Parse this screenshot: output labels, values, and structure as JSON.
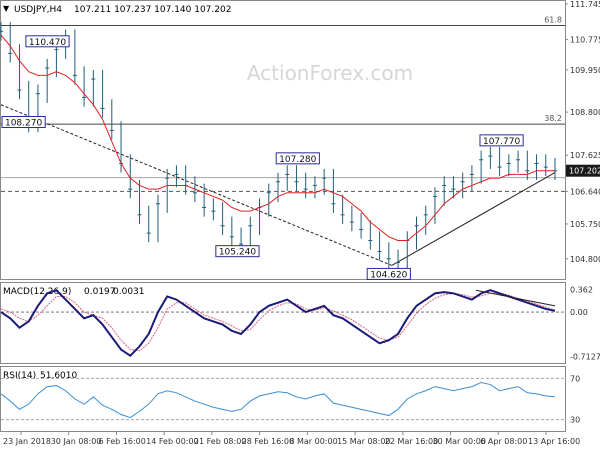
{
  "chart_data": {
    "type": "line",
    "symbol_label": "USDJPY,H4",
    "ohlc_readout": "107.211 107.237 107.140 107.202",
    "watermark": "ActionForex.com",
    "price_axis": {
      "ticks": [
        "111.745",
        "110.775",
        "109.950",
        "108.800",
        "107.625",
        "106.640",
        "105.750",
        "104.800"
      ],
      "ylim": [
        104.25,
        111.8
      ]
    },
    "current_price": {
      "value": 107.202,
      "label": "107.202"
    },
    "support_line": {
      "value": 106.64,
      "label": "106.640"
    },
    "fib_levels": [
      {
        "label": "61.8",
        "value": 111.16
      },
      {
        "label": "38.2",
        "value": 108.47
      }
    ],
    "level_line_107010": {
      "value": 107.01,
      "label": "107.010"
    },
    "annotations": [
      {
        "label": "110.470",
        "value": 110.47,
        "index": 47
      },
      {
        "label": "108.270",
        "value": 108.27,
        "index": 2
      },
      {
        "label": "107.280",
        "value": 107.28,
        "index": 300
      },
      {
        "label": "105.240",
        "value": 105.24,
        "index": 239
      },
      {
        "label": "104.620",
        "value": 104.62,
        "index": 392
      },
      {
        "label": "107.770",
        "value": 107.77,
        "index": 506
      }
    ],
    "trendlines": [
      {
        "from": [
          0,
          109.0
        ],
        "to": [
          395,
          104.62
        ]
      },
      {
        "from": [
          395,
          104.62
        ],
        "to": [
          560,
          107.15
        ]
      }
    ],
    "series": [
      {
        "name": "price",
        "values": [
          111.0,
          110.4,
          109.4,
          108.5,
          109.3,
          110.0,
          110.5,
          110.8,
          109.8,
          109.2,
          109.7,
          108.9,
          108.3,
          107.4,
          106.7,
          106.0,
          105.5,
          106.3,
          107.0,
          107.1,
          106.8,
          106.6,
          106.2,
          106.1,
          105.7,
          105.4,
          105.2,
          105.7,
          106.2,
          106.6,
          106.9,
          107.1,
          106.9,
          106.7,
          106.8,
          107.0,
          106.3,
          106.0,
          105.8,
          105.6,
          105.3,
          105.0,
          104.8,
          104.7,
          105.3,
          105.7,
          106.0,
          106.5,
          106.8,
          106.7,
          106.9,
          107.1,
          107.5,
          107.6,
          107.3,
          107.4,
          107.5,
          107.2,
          107.4,
          107.3,
          107.2
        ]
      },
      {
        "name": "sma",
        "values": [
          110.9,
          110.6,
          110.2,
          109.9,
          109.8,
          109.8,
          109.9,
          109.8,
          109.6,
          109.3,
          109.0,
          108.6,
          108.0,
          107.4,
          107.0,
          106.8,
          106.7,
          106.7,
          106.8,
          106.8,
          106.8,
          106.7,
          106.6,
          106.5,
          106.4,
          106.2,
          106.1,
          106.1,
          106.2,
          106.3,
          106.5,
          106.6,
          106.6,
          106.6,
          106.6,
          106.7,
          106.6,
          106.5,
          106.3,
          106.1,
          105.8,
          105.6,
          105.4,
          105.3,
          105.3,
          105.5,
          105.7,
          106.0,
          106.3,
          106.5,
          106.7,
          106.8,
          106.9,
          107.0,
          107.0,
          107.1,
          107.1,
          107.1,
          107.2,
          107.2,
          107.2
        ]
      }
    ],
    "macd": {
      "label": "MACD(12,26,9)",
      "value_a": "0.0197",
      "value_b": "0.0031",
      "ticks": [
        "0.362",
        "0.00",
        "-0.7127"
      ],
      "ylim": [
        -0.8,
        0.45
      ],
      "series": [
        {
          "name": "macd",
          "values": [
            0.0,
            -0.1,
            -0.25,
            -0.15,
            0.1,
            0.3,
            0.35,
            0.2,
            0.05,
            -0.1,
            -0.05,
            -0.2,
            -0.4,
            -0.6,
            -0.7,
            -0.55,
            -0.35,
            0.0,
            0.25,
            0.2,
            0.1,
            0.0,
            -0.1,
            -0.15,
            -0.2,
            -0.3,
            -0.35,
            -0.2,
            0.0,
            0.1,
            0.15,
            0.2,
            0.1,
            0.0,
            0.05,
            0.1,
            -0.05,
            -0.1,
            -0.2,
            -0.3,
            -0.4,
            -0.5,
            -0.45,
            -0.35,
            -0.1,
            0.1,
            0.2,
            0.3,
            0.32,
            0.3,
            0.25,
            0.2,
            0.3,
            0.35,
            0.3,
            0.25,
            0.2,
            0.15,
            0.1,
            0.05,
            0.02
          ]
        },
        {
          "name": "signal",
          "values": [
            0.05,
            0.0,
            -0.1,
            -0.15,
            -0.05,
            0.1,
            0.25,
            0.25,
            0.15,
            0.0,
            -0.05,
            -0.1,
            -0.25,
            -0.45,
            -0.6,
            -0.62,
            -0.5,
            -0.25,
            0.05,
            0.15,
            0.15,
            0.05,
            -0.05,
            -0.1,
            -0.15,
            -0.22,
            -0.3,
            -0.28,
            -0.12,
            0.02,
            0.1,
            0.15,
            0.13,
            0.05,
            0.03,
            0.07,
            0.02,
            -0.05,
            -0.12,
            -0.22,
            -0.32,
            -0.42,
            -0.45,
            -0.4,
            -0.22,
            -0.02,
            0.12,
            0.22,
            0.28,
            0.3,
            0.28,
            0.24,
            0.26,
            0.3,
            0.3,
            0.27,
            0.22,
            0.18,
            0.13,
            0.08,
            0.03
          ]
        }
      ]
    },
    "rsi": {
      "label": "RSI(14)",
      "value": "51.6010",
      "ticks": [
        "70",
        "30"
      ],
      "ylim": [
        20,
        80
      ],
      "values": [
        55,
        48,
        40,
        45,
        55,
        62,
        63,
        58,
        50,
        45,
        52,
        44,
        40,
        35,
        32,
        38,
        45,
        55,
        58,
        56,
        52,
        48,
        45,
        42,
        40,
        38,
        40,
        48,
        53,
        55,
        57,
        56,
        52,
        50,
        53,
        55,
        46,
        44,
        42,
        40,
        38,
        36,
        34,
        40,
        50,
        55,
        58,
        62,
        60,
        58,
        60,
        62,
        66,
        64,
        58,
        60,
        62,
        56,
        55,
        53,
        52
      ]
    },
    "x_axis": {
      "labels": [
        "23 Jan 2018",
        "30 Jan 08:00",
        "6 Feb 16:00",
        "14 Feb 00:00",
        "21 Feb 08:00",
        "28 Feb 16:00",
        "8 Mar 00:00",
        "15 Mar 08:00",
        "22 Mar 16:00",
        "30 Mar 00:00",
        "6 Apr 08:00",
        "13 Apr 16:00"
      ]
    },
    "colors": {
      "price": "#1f5f7a",
      "sma": "#e02020",
      "macd": "#1a1a7a",
      "signal": "#e06080",
      "rsi": "#3a8fd6",
      "annotation_border": "#2a2a9a",
      "current_price_bg": "#1a1a1a"
    }
  }
}
